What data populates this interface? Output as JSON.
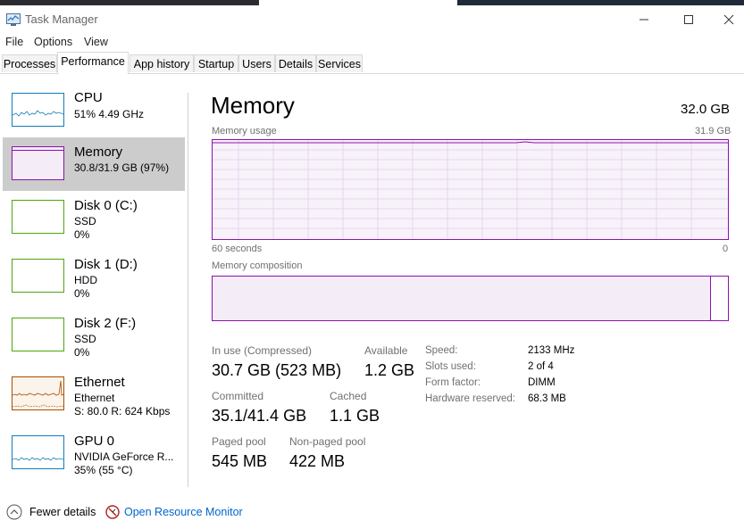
{
  "window": {
    "title": "Task Manager"
  },
  "menu": [
    "File",
    "Options",
    "View"
  ],
  "tabs": [
    {
      "label": "Processes"
    },
    {
      "label": "Performance"
    },
    {
      "label": "App history"
    },
    {
      "label": "Startup"
    },
    {
      "label": "Users"
    },
    {
      "label": "Details"
    },
    {
      "label": "Services"
    }
  ],
  "sidebar": [
    {
      "name": "CPU",
      "line1": "51%  4.49 GHz",
      "line2": "",
      "color": "#117dbb"
    },
    {
      "name": "Memory",
      "line1": "30.8/31.9 GB (97%)",
      "line2": "",
      "color": "#8b12ae"
    },
    {
      "name": "Disk 0 (C:)",
      "line1": "SSD",
      "line2": "0%",
      "color": "#4da60c"
    },
    {
      "name": "Disk 1 (D:)",
      "line1": "HDD",
      "line2": "0%",
      "color": "#4da60c"
    },
    {
      "name": "Disk 2 (F:)",
      "line1": "SSD",
      "line2": "0%",
      "color": "#4da60c"
    },
    {
      "name": "Ethernet",
      "line1": "Ethernet",
      "line2": "S: 80.0  R: 624 Kbps",
      "color": "#a74f01"
    },
    {
      "name": "GPU 0",
      "line1": "NVIDIA GeForce R...",
      "line2": "35%  (55 °C)",
      "color": "#117dbb"
    }
  ],
  "main": {
    "title": "Memory",
    "total": "32.0 GB",
    "usage_label": "Memory usage",
    "usage_max": "31.9 GB",
    "time_label": "60 seconds",
    "time_end": "0",
    "composition_label": "Memory composition",
    "accent": "#8b12ae"
  },
  "stats": {
    "in_use_label": "In use (Compressed)",
    "in_use_value": "30.7 GB (523 MB)",
    "available_label": "Available",
    "available_value": "1.2 GB",
    "committed_label": "Committed",
    "committed_value": "35.1/41.4 GB",
    "cached_label": "Cached",
    "cached_value": "1.1 GB",
    "paged_label": "Paged pool",
    "paged_value": "545 MB",
    "nonpaged_label": "Non-paged pool",
    "nonpaged_value": "422 MB"
  },
  "details": [
    {
      "label": "Speed:",
      "value": "2133 MHz"
    },
    {
      "label": "Slots used:",
      "value": "2 of 4"
    },
    {
      "label": "Form factor:",
      "value": "DIMM"
    },
    {
      "label": "Hardware reserved:",
      "value": "68.3 MB"
    }
  ],
  "footer": {
    "fewer_details": "Fewer details",
    "open_monitor": "Open Resource Monitor"
  }
}
